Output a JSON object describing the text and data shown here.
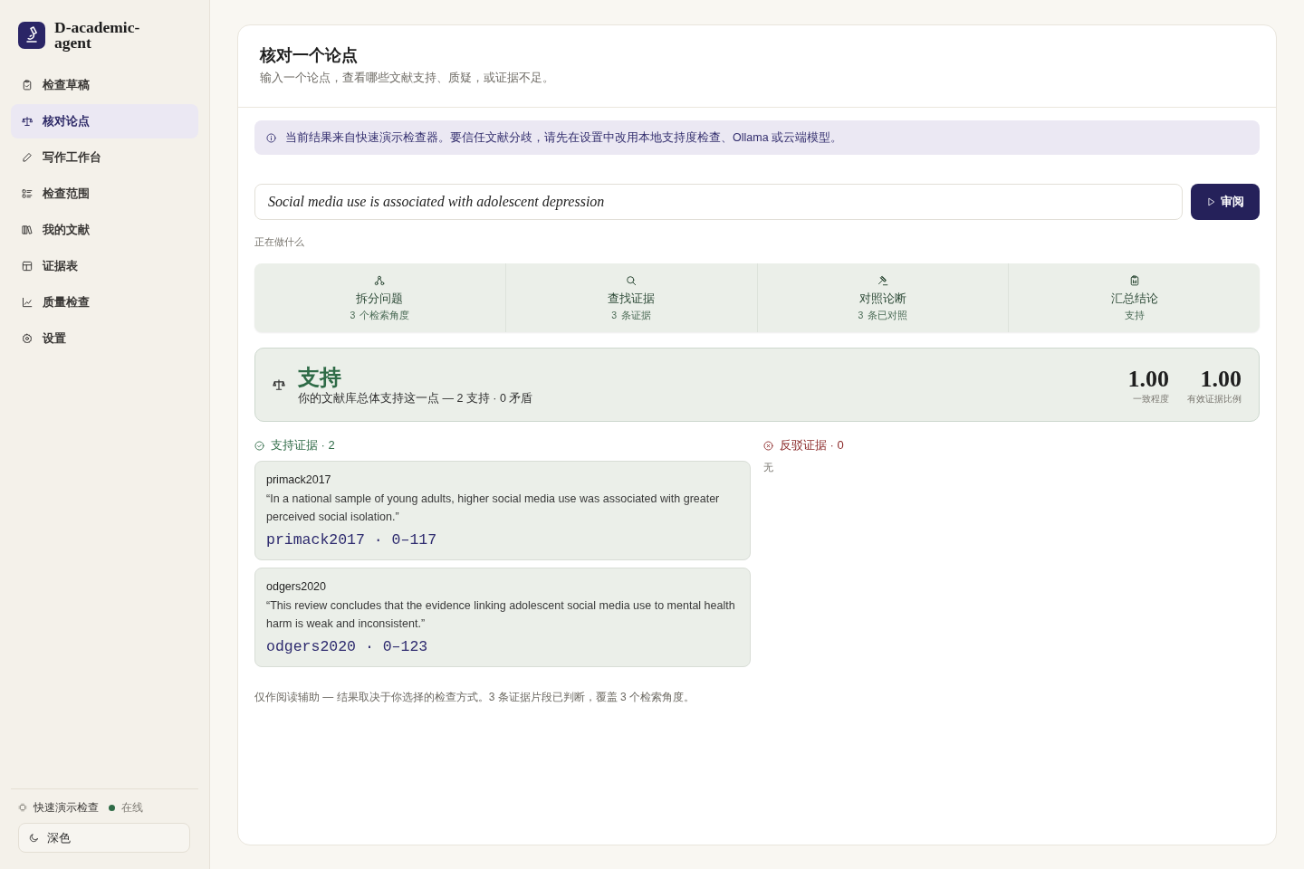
{
  "sidebar": {
    "brand": "D-academic-agent",
    "nav": [
      {
        "label": "检查草稿",
        "selected": false
      },
      {
        "label": "核对论点",
        "selected": true
      },
      {
        "label": "写作工作台",
        "selected": false
      },
      {
        "label": "检查范围",
        "selected": false
      },
      {
        "label": "我的文献",
        "selected": false
      },
      {
        "label": "证据表",
        "selected": false
      },
      {
        "label": "质量检查",
        "selected": false
      },
      {
        "label": "设置",
        "selected": false
      }
    ],
    "status": {
      "engine": "快速演示检查",
      "online": true,
      "state": "在线"
    },
    "theme_button": "深色"
  },
  "header": {
    "title": "核对一个论点",
    "subtitle": "输入一个论点，查看哪些文献支持、质疑，或证据不足。"
  },
  "notice": "当前结果来自快速演示检查器。要信任文献分歧，请先在设置中改用本地支持度检查、Ollama 或云端模型。",
  "claim_input": {
    "value": "Social media use is associated with adolescent depression"
  },
  "review_button": "审阅",
  "progress": {
    "label": "正在做什么",
    "steps": [
      {
        "title": "拆分问题",
        "count": "3",
        "detail": "个检索角度"
      },
      {
        "title": "查找证据",
        "count": "3",
        "detail": "条证据"
      },
      {
        "title": "对照论断",
        "count": "3",
        "detail": "条已对照"
      },
      {
        "title": "汇总结论",
        "detail": "支持"
      }
    ]
  },
  "verdict": {
    "kind": "support",
    "label": "支持",
    "summary": "你的文献库总体支持这一点 — 2 支持 · 0 矛盾",
    "metrics": [
      {
        "value": "1.00",
        "label": "一致程度"
      },
      {
        "value": "1.00",
        "label": "有效证据比例"
      }
    ]
  },
  "evidence": [
    {
      "kind": "support",
      "heading": "支持证据 · 2",
      "items": [
        {
          "source": "primack2017",
          "quote": "“In a national sample of young adults, higher social media use was associated with greater perceived social isolation.”",
          "citation": "primack2017 · 0–117"
        },
        {
          "source": "odgers2020",
          "quote": "“This review concludes that the evidence linking adolescent social media use to mental health harm is weak and inconsistent.”",
          "citation": "odgers2020 · 0–123"
        }
      ]
    },
    {
      "kind": "refute",
      "heading": "反驳证据 · 0",
      "empty_text": "无"
    }
  ],
  "footnote": "仅作阅读辅助 — 结果取决于你选择的检查方式。3 条证据片段已判断，覆盖 3 个检索角度。"
}
